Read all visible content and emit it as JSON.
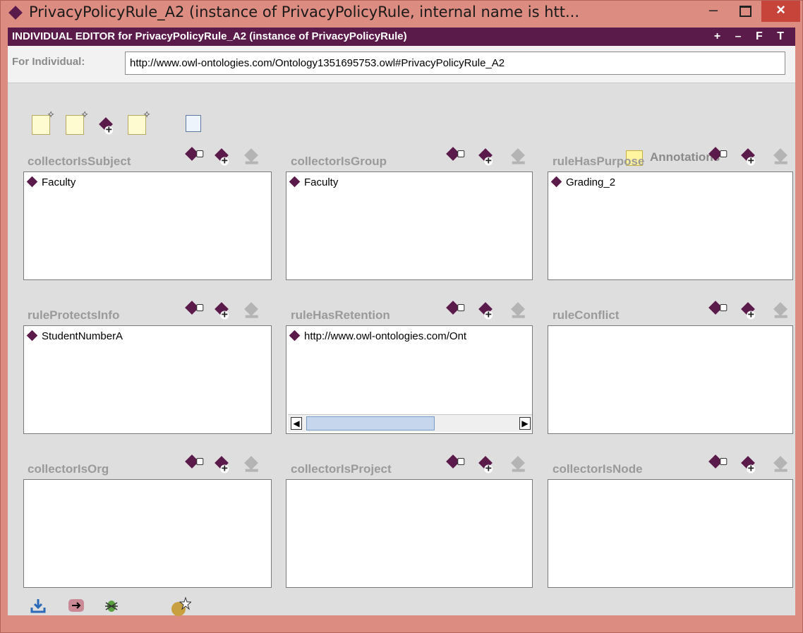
{
  "window": {
    "title": "PrivacyPolicyRule_A2   (instance of PrivacyPolicyRule, internal name is htt...",
    "minimize_label": "–",
    "close_label": "×"
  },
  "editor": {
    "header": "INDIVIDUAL EDITOR for PrivacyPolicyRule_A2   (instance of PrivacyPolicyRule)",
    "header_tools": "+ – F T",
    "for_label": "For Individual:",
    "for_value": "http://www.owl-ontologies.com/Ontology1351695753.owl#PrivacyPolicyRule_A2"
  },
  "annotations_label": "Annotations",
  "panels": [
    {
      "label": "collectorIsSubject",
      "items": [
        "Faculty"
      ]
    },
    {
      "label": "collectorIsGroup",
      "items": [
        "Faculty"
      ]
    },
    {
      "label": "ruleHasPurpose",
      "items": [
        "Grading_2"
      ]
    },
    {
      "label": "ruleProtectsInfo",
      "items": [
        "StudentNumberA"
      ]
    },
    {
      "label": "ruleHasRetention",
      "items": [
        "http://www.owl-ontologies.com/Ont"
      ]
    },
    {
      "label": "ruleConflict",
      "items": []
    },
    {
      "label": "collectorIsOrg",
      "items": []
    },
    {
      "label": "collectorIsProject",
      "items": []
    },
    {
      "label": "collectorIsNode",
      "items": []
    }
  ],
  "toolbar_icons": [
    "new-document-icon",
    "new-document-ds-icon",
    "create-instance-icon",
    "delete-document-icon",
    "properties-panel-icon"
  ],
  "bottom_icons": [
    "import-icon",
    "arrow-right-icon",
    "bug-icon",
    "new-instance-icon"
  ]
}
